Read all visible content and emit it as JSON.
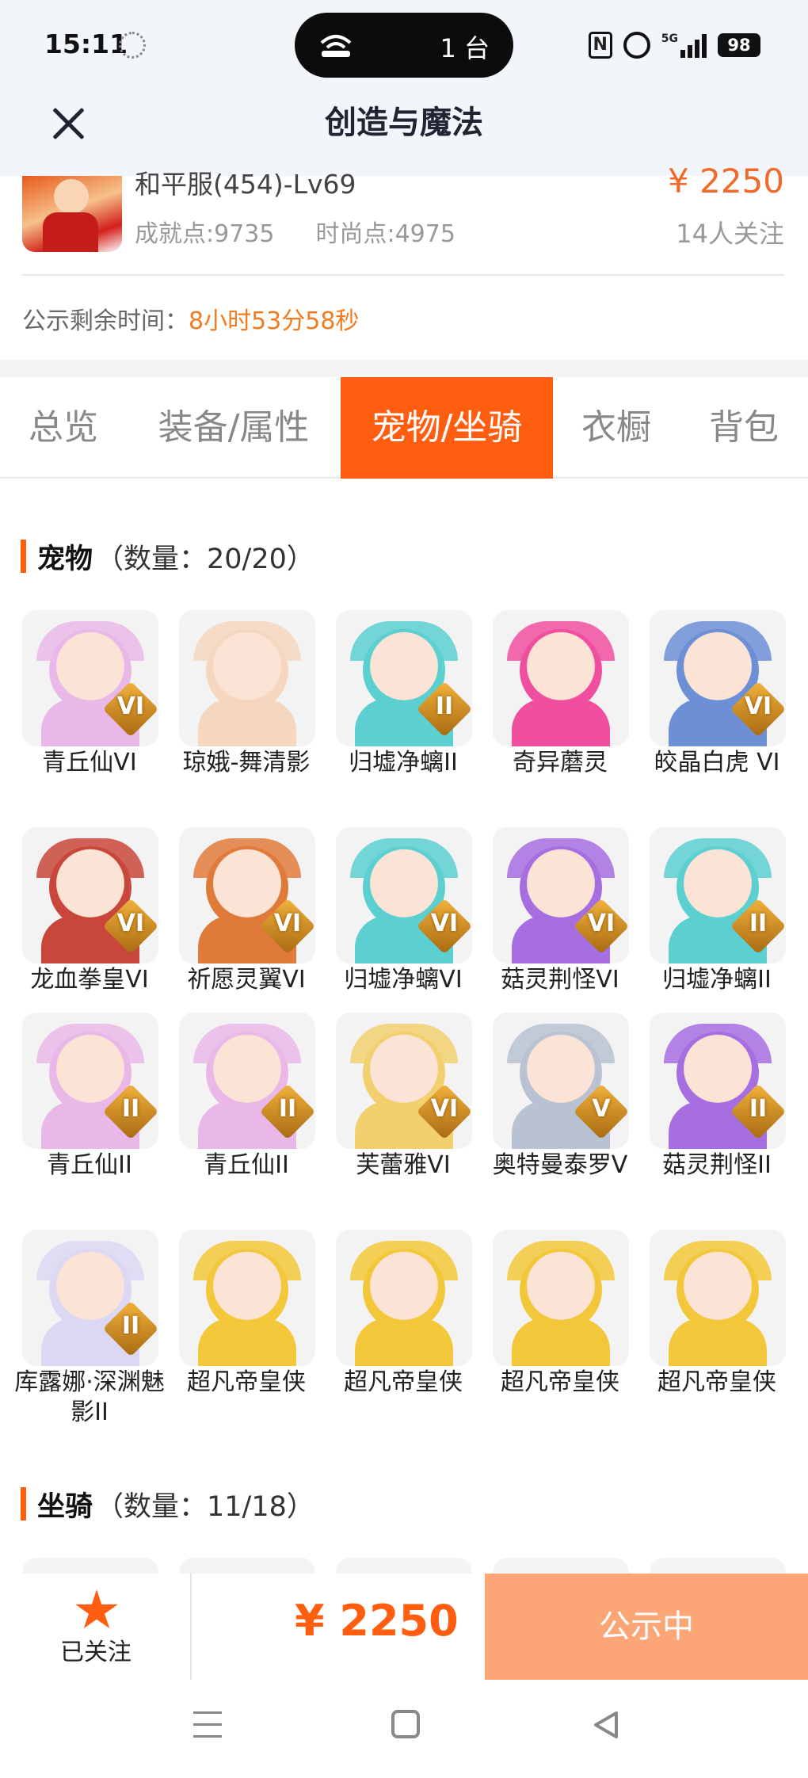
{
  "status_bar": {
    "time": "15:11",
    "device_count": "1 台",
    "nfc": "N",
    "network": "5G",
    "battery": "98"
  },
  "header": {
    "title": "创造与魔法"
  },
  "product": {
    "server": "和平服(454)-Lv69",
    "price": "¥ 2250",
    "achievement": "成就点:9735",
    "fashion": "时尚点:4975",
    "followers": "14人关注",
    "countdown_label": "公示剩余时间：",
    "countdown_value": "8小时53分58秒"
  },
  "tabs": [
    {
      "label": "总览",
      "active": false
    },
    {
      "label": "装备/属性",
      "active": false
    },
    {
      "label": "宠物/坐骑",
      "active": true
    },
    {
      "label": "衣橱",
      "active": false
    },
    {
      "label": "背包",
      "active": false
    }
  ],
  "pets_section": {
    "title": "宠物",
    "count": "（数量：20/20）"
  },
  "pets": [
    {
      "name": "青丘仙VI",
      "grade": "VI",
      "color": "#e9b8e8"
    },
    {
      "name": "琼娥-舞清影",
      "grade": "",
      "color": "#f5d7c0"
    },
    {
      "name": "归墟净螭II",
      "grade": "II",
      "color": "#5ccfd0"
    },
    {
      "name": "奇异蘑灵",
      "grade": "",
      "color": "#f04fa0"
    },
    {
      "name": "皎晶白虎 VI",
      "grade": "VI",
      "color": "#6d8fd6"
    },
    {
      "name": "龙血拳皇VI",
      "grade": "VI",
      "color": "#c8463a"
    },
    {
      "name": "祈愿灵翼VI",
      "grade": "VI",
      "color": "#e07a3a"
    },
    {
      "name": "归墟净螭VI",
      "grade": "VI",
      "color": "#5ccfd0"
    },
    {
      "name": "菇灵荆怪VI",
      "grade": "VI",
      "color": "#a66ee0"
    },
    {
      "name": "归墟净螭II",
      "grade": "II",
      "color": "#5ccfd0"
    },
    {
      "name": "青丘仙II",
      "grade": "II",
      "color": "#e9b8e8"
    },
    {
      "name": "青丘仙II",
      "grade": "II",
      "color": "#e9b8e8"
    },
    {
      "name": "芙蕾雅VI",
      "grade": "VI",
      "color": "#f2d070"
    },
    {
      "name": "奥特曼泰罗V",
      "grade": "V",
      "color": "#b9c2d2"
    },
    {
      "name": "菇灵荆怪II",
      "grade": "II",
      "color": "#a66ee0"
    },
    {
      "name": "库露娜·深渊魅影II",
      "grade": "II",
      "color": "#dcd7f2"
    },
    {
      "name": "超凡帝皇侠",
      "grade": "",
      "color": "#f2c83a"
    },
    {
      "name": "超凡帝皇侠",
      "grade": "",
      "color": "#f2c83a"
    },
    {
      "name": "超凡帝皇侠",
      "grade": "",
      "color": "#f2c83a"
    },
    {
      "name": "超凡帝皇侠",
      "grade": "",
      "color": "#f2c83a"
    }
  ],
  "mounts_section": {
    "title": "坐骑",
    "count": "（数量：11/18）"
  },
  "bottom": {
    "follow_label": "已关注",
    "price": "¥ 2250",
    "status_label": "公示中"
  },
  "colors": {
    "accent": "#ff5e10",
    "price": "#f16a2a",
    "status_button": "#fca677"
  }
}
